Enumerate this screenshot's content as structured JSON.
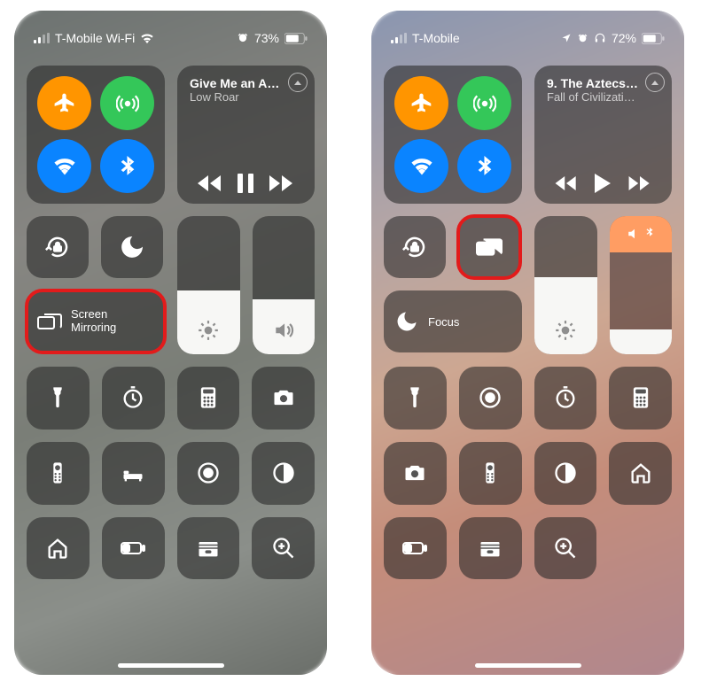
{
  "left": {
    "carrier": "T-Mobile Wi-Fi",
    "battery_pct": "73%",
    "media_title": "Give Me an A…",
    "media_sub": "Low Roar",
    "screen_mirror_line1": "Screen",
    "screen_mirror_line2": "Mirroring",
    "brightness_fill": "46%",
    "volume_fill": "40%"
  },
  "right": {
    "carrier": "T-Mobile",
    "battery_pct": "72%",
    "media_title": "9. The Aztecs…",
    "media_sub": "Fall of Civilizati…",
    "focus_label": "Focus",
    "brightness_fill": "56%",
    "volume_fill": "18%"
  }
}
